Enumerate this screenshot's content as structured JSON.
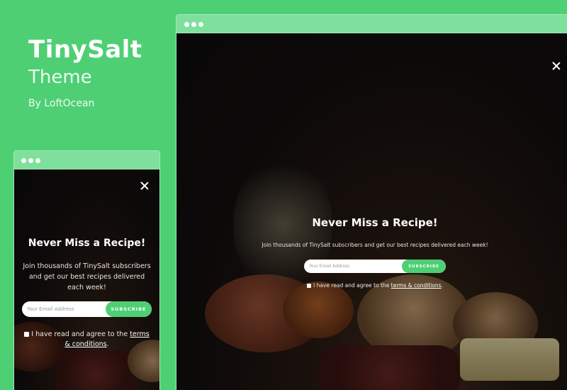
{
  "brand": {
    "title": "TinySalt",
    "subtitle": "Theme",
    "byline": "By LoftOcean"
  },
  "popup": {
    "title": "Never Miss a Recipe!",
    "description": "Join thousands of TinySalt subscribers and get our best recipes delivered each week!",
    "email_placeholder": "Your Email Address",
    "subscribe_label": "SUBSCRIBE",
    "agree_text": "I have read and agree to the ",
    "terms_label": "terms & conditions",
    "agree_suffix": "."
  },
  "colors": {
    "accent": "#4fcf74",
    "window_bar": "#7ee09c",
    "overlay_bg": "#141010"
  },
  "icons": {
    "close": "close-icon",
    "window_dots": "window-control-dots"
  }
}
